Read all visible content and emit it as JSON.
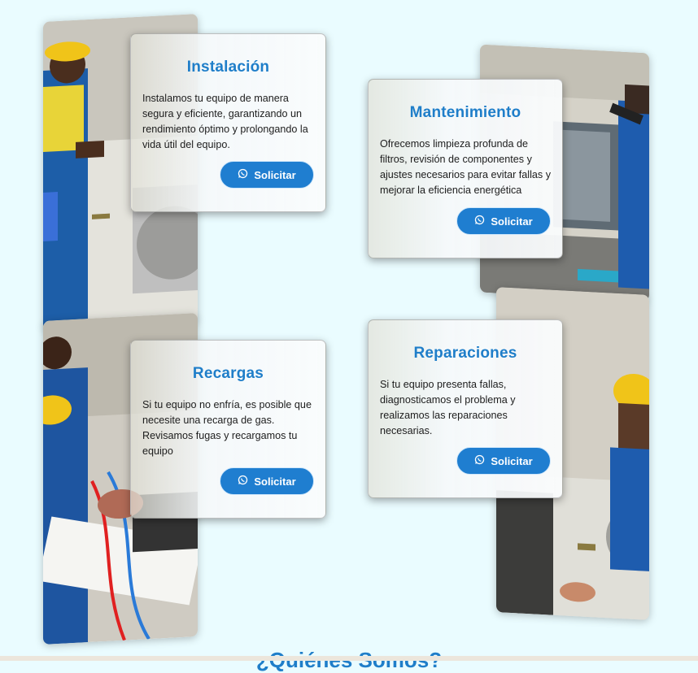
{
  "services": [
    {
      "title": "Instalación",
      "description": "Instalamos tu equipo de manera segura y eficiente, garantizando un rendimiento óptimo y prolongando la vida útil del equipo.",
      "button_label": "Solicitar"
    },
    {
      "title": "Mantenimiento",
      "description": "Ofrecemos limpieza profunda de filtros, revisión de componentes y ajustes necesarios para evitar fallas y mejorar la eficiencia energética",
      "button_label": "Solicitar"
    },
    {
      "title": "Recargas",
      "description": "Si tu equipo no enfría, es posible que necesite una recarga de gas. Revisamos fugas y recargamos tu equipo",
      "button_label": "Solicitar"
    },
    {
      "title": "Reparaciones",
      "description": "Si tu equipo presenta fallas, diagnosticamos el problema y realizamos las reparaciones necesarias.",
      "button_label": "Solicitar"
    }
  ],
  "next_section": {
    "title": "¿Quiénes Somos?"
  },
  "colors": {
    "accent": "#1f7ec9",
    "button": "#1f7ed0",
    "background": "#eafcff"
  }
}
